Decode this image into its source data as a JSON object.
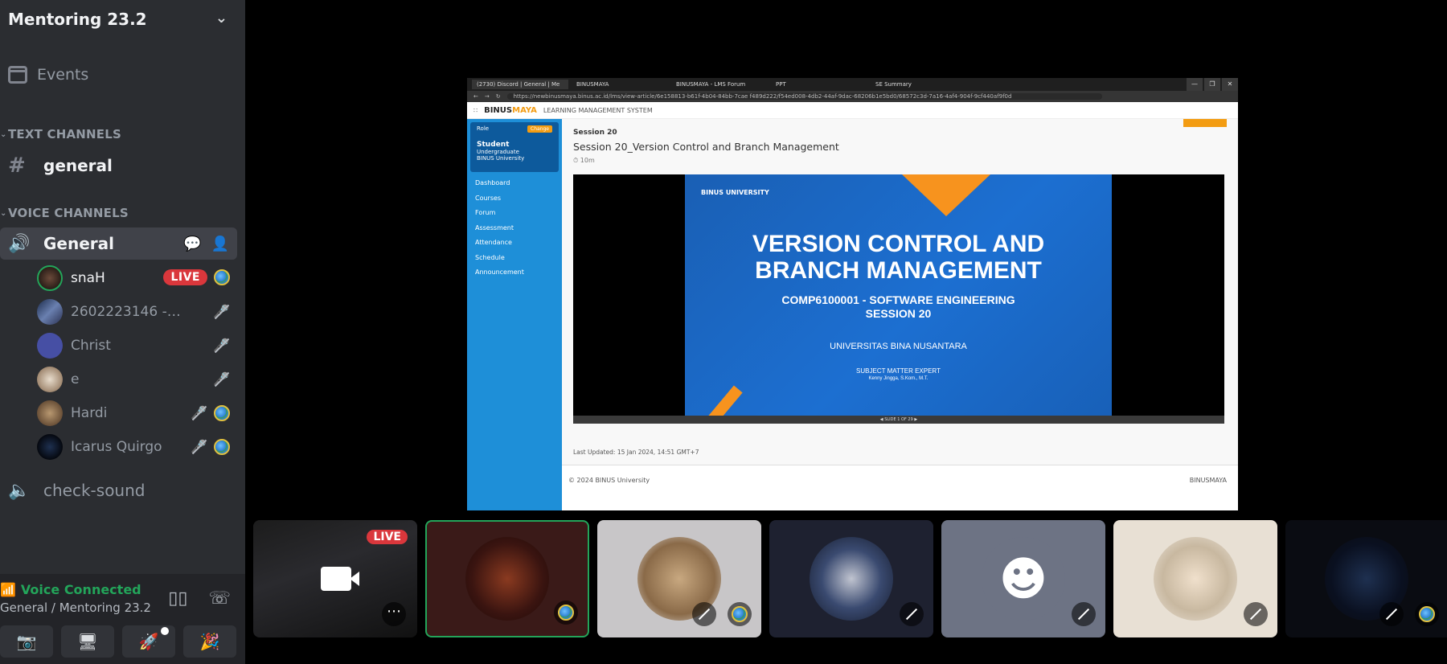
{
  "server": {
    "name": "Mentoring 23.2"
  },
  "sidebar": {
    "events_label": "Events",
    "text_category": "TEXT CHANNELS",
    "text_channel": "general",
    "voice_category": "VOICE CHANNELS",
    "voice_channel": "General",
    "users": [
      {
        "name": "snaH",
        "live": "LIVE"
      },
      {
        "name": "2602223146 - Zefa..."
      },
      {
        "name": "Christ"
      },
      {
        "name": "e"
      },
      {
        "name": "Hardi"
      },
      {
        "name": "Icarus Quirgo"
      }
    ],
    "other_channel": "check-sound"
  },
  "voice_panel": {
    "status": "Voice Connected",
    "location": "General / Mentoring 23.2"
  },
  "stage": {
    "browser_tabs": [
      "(2730) Discord | General | Me",
      "BINUSMAYA",
      "BINUSMAYA - LMS Forum",
      "PPT",
      "SE Summary"
    ],
    "url": "https://newbinusmaya.binus.ac.id/lms/view-article/6e158813-b61f-4b04-84bb-7cae f489d222/f54ed008-4db2-44af-9dac-68206b1e5bd0/68572c3d-7a16-4af4-904f-9cf440af9f0d",
    "lms_header": "LEARNING MANAGEMENT SYSTEM",
    "logo_a": "BINUS",
    "logo_b": "MAYA",
    "role_label": "Role",
    "change_label": "Change",
    "role_name": "Student",
    "role_level": "Undergraduate",
    "role_uni": "BINUS University",
    "nav": [
      "Dashboard",
      "Courses",
      "Forum",
      "Assessment",
      "Attendance",
      "Schedule",
      "Announcement"
    ],
    "session_label": "Session 20",
    "session_title": "Session 20_Version Control and Branch Management",
    "duration": "10m",
    "slide_title_1": "VERSION CONTROL AND",
    "slide_title_2": "BRANCH MANAGEMENT",
    "slide_course": "COMP6100001 - SOFTWARE ENGINEERING",
    "slide_session": "SESSION 20",
    "slide_uni": "UNIVERSITAS BINA NUSANTARA",
    "slide_sme": "SUBJECT MATTER EXPERT",
    "slide_person": "Kenny Jingga, S.Kom., M.T.",
    "slide_logo": "BINUS UNIVERSITY",
    "slide_counter": "SLIDE 1 OF 29",
    "updated": "Last Updated: 15 Jan 2024, 14:51 GMT+7",
    "footer_left": "© 2024 BINUS University",
    "footer_right": "BINUSMAYA"
  },
  "tiles": {
    "live_label": "LIVE"
  }
}
